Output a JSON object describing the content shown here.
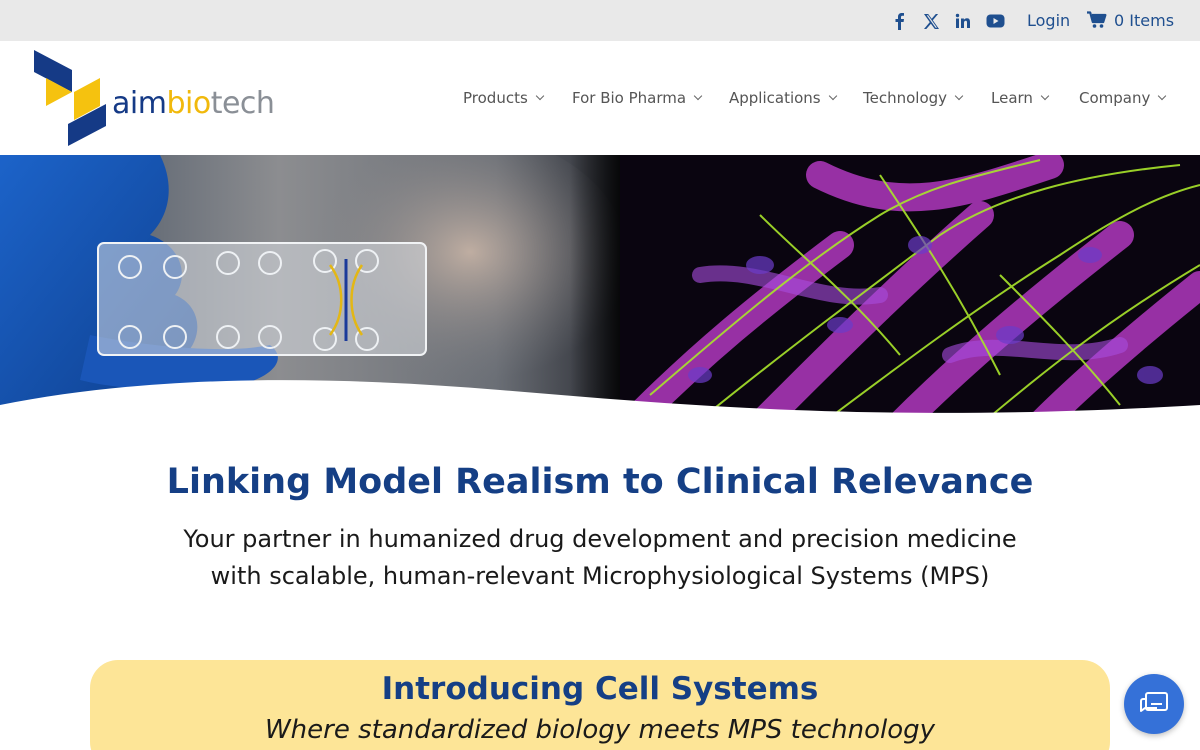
{
  "topbar": {
    "social": [
      "facebook-icon",
      "x-twitter-icon",
      "linkedin-icon",
      "youtube-icon"
    ],
    "login_label": "Login",
    "cart_label": "0 Items"
  },
  "logo": {
    "part1": "aim",
    "part2": "bio",
    "part3": "tech"
  },
  "nav": {
    "items": [
      {
        "label": "Products"
      },
      {
        "label": "For Bio Pharma"
      },
      {
        "label": "Applications"
      },
      {
        "label": "Technology"
      },
      {
        "label": "Learn"
      },
      {
        "label": "Company"
      }
    ]
  },
  "main": {
    "headline": "Linking Model Realism to Clinical Relevance",
    "subline_1": "Your partner in humanized drug development and precision medicine",
    "subline_2": "with scalable, human-relevant Microphysiological Systems (MPS)"
  },
  "card": {
    "title": "Introducing Cell Systems",
    "subtitle": "Where standardized biology meets MPS technology"
  },
  "colors": {
    "brand_blue": "#153f85",
    "brand_yellow": "#f1b90c",
    "card_bg": "#fde597",
    "chat_button": "#3571d8",
    "topbar_bg": "#e9e9e9"
  }
}
